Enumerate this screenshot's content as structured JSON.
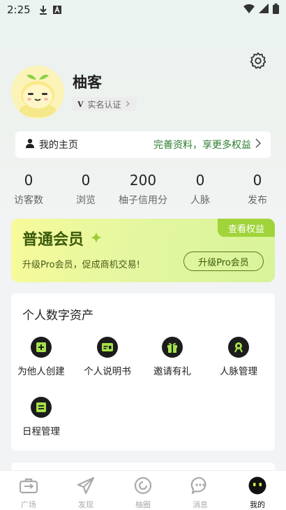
{
  "status_bar": {
    "time": "2:25"
  },
  "profile": {
    "nickname": "柚客",
    "verify_label": "实名认证",
    "verify_badge": "V"
  },
  "homepage": {
    "label": "我的主页",
    "cta": "完善资料，享更多权益"
  },
  "stats": [
    {
      "value": "0",
      "label": "访客数"
    },
    {
      "value": "0",
      "label": "浏览"
    },
    {
      "value": "200",
      "label": "柚子信用分"
    },
    {
      "value": "0",
      "label": "人脉"
    },
    {
      "value": "0",
      "label": "发布"
    }
  ],
  "membership": {
    "title": "普通会员",
    "view_benefits": "查看权益",
    "subtitle": "升级Pro会员，促成商机交易!",
    "upgrade_button": "升级Pro会员",
    "accent": "#a0d43a"
  },
  "assets": {
    "heading": "个人数字资产",
    "items": [
      {
        "label": "为他人创建",
        "icon": "plus-square-icon"
      },
      {
        "label": "个人说明书",
        "icon": "card-icon"
      },
      {
        "label": "邀请有礼",
        "icon": "gift-icon"
      },
      {
        "label": "人脉管理",
        "icon": "network-icon"
      },
      {
        "label": "日程管理",
        "icon": "schedule-icon"
      }
    ]
  },
  "tabbar": {
    "items": [
      {
        "label": "广场",
        "icon": "briefcase-icon"
      },
      {
        "label": "发现",
        "icon": "paper-plane-icon"
      },
      {
        "label": "柚圈",
        "icon": "circle-refresh-icon"
      },
      {
        "label": "消息",
        "icon": "chat-bubble-icon"
      },
      {
        "label": "我的",
        "icon": "face-icon",
        "active": true
      }
    ]
  }
}
